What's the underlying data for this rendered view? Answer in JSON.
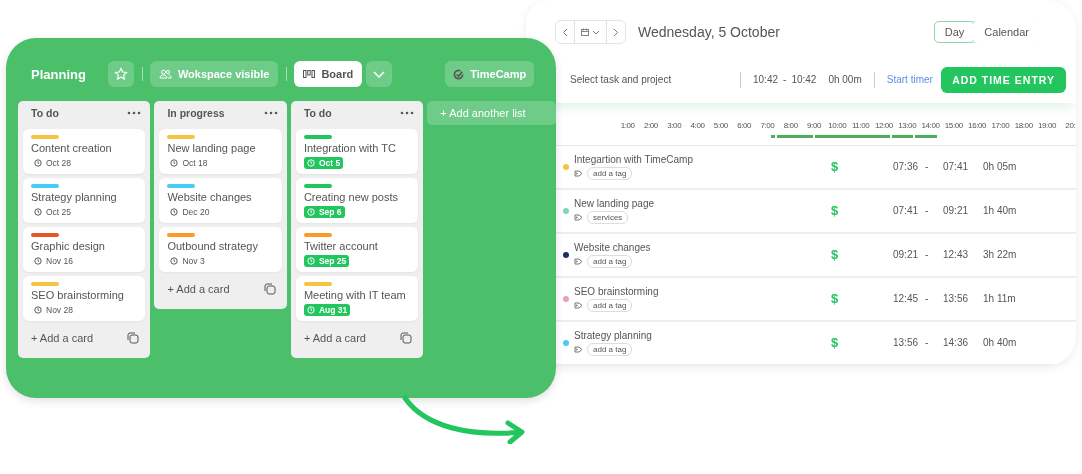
{
  "board": {
    "title": "Planning",
    "visibility": "Wokspace visible",
    "view": "Board",
    "integration": "TimeCamp",
    "lists": [
      {
        "title": "To do",
        "footer": "+ Add a card",
        "cards": [
          {
            "title": "Content creation",
            "color": "#f5c542",
            "date": "Oct 28",
            "highlighted": false
          },
          {
            "title": "Strategy planning",
            "color": "#45cdf5",
            "date": "Oct 25",
            "highlighted": false
          },
          {
            "title": "Graphic design",
            "color": "#e8542a",
            "date": "Nov 16",
            "highlighted": false
          },
          {
            "title": "SEO brainstorming",
            "color": "#f5c542",
            "date": "Nov 28",
            "highlighted": false
          }
        ]
      },
      {
        "title": "In progress",
        "footer": "+ Add a card",
        "cards": [
          {
            "title": "New landing page",
            "color": "#f5c542",
            "date": "Oct 18",
            "highlighted": false
          },
          {
            "title": "Website changes",
            "color": "#45cdf5",
            "date": "Dec 20",
            "highlighted": false
          },
          {
            "title": "Outbound strategy",
            "color": "#fb9a25",
            "date": "Nov 3",
            "highlighted": false
          }
        ]
      },
      {
        "title": "To do",
        "footer": "+ Add a card",
        "cards": [
          {
            "title": "Integration with TC",
            "color": "#22c55e",
            "date": "Oct 5",
            "highlighted": true
          },
          {
            "title": "Creating new posts",
            "color": "#22c55e",
            "date": "Sep 6",
            "highlighted": true
          },
          {
            "title": "Twitter account",
            "color": "#fb9a25",
            "date": "Sep 25",
            "highlighted": true
          },
          {
            "title": "Meeting with IT team",
            "color": "#f5c542",
            "date": "Aug 31",
            "highlighted": true
          }
        ]
      }
    ],
    "add_list": "+ Add another list"
  },
  "timesheet": {
    "date": "Wednesday, 5 October",
    "views": [
      {
        "label": "Day",
        "selected": true
      },
      {
        "label": "Calendar",
        "selected": false
      }
    ],
    "entry": {
      "placeholder": "Select task and project",
      "start": "10:42",
      "separator": "-",
      "end": "10:42",
      "duration": "0h 00m",
      "timer_link": "Start timer",
      "add_button": "ADD TIME ENTRY"
    },
    "hours": [
      "1:00",
      "2:00",
      "3:00",
      "4:00",
      "5:00",
      "6:00",
      "7:00",
      "8:00",
      "9:00",
      "10:00",
      "11:00",
      "12:00",
      "13:00",
      "14:00",
      "15:00",
      "16:00",
      "17:00",
      "18:00",
      "19:00",
      "20:"
    ],
    "entries": [
      {
        "task": "Integartion with TimeCamp",
        "color": "#f5c542",
        "tag": "add a tag",
        "billable": "$",
        "start": "07:36",
        "separator": "-",
        "end": "07:41",
        "duration": "0h 05m"
      },
      {
        "task": "New landing page",
        "color": "#7fd6b8",
        "tag": "services",
        "billable": "$",
        "start": "07:41",
        "separator": "-",
        "end": "09:21",
        "duration": "1h 40m"
      },
      {
        "task": "Website changes",
        "color": "#1b2e6b",
        "tag": "add a tag",
        "billable": "$",
        "start": "09:21",
        "separator": "-",
        "end": "12:43",
        "duration": "3h 22m"
      },
      {
        "task": "SEO brainstorming",
        "color": "#eaa2b8",
        "tag": "add a tag",
        "billable": "$",
        "start": "12:45",
        "separator": "-",
        "end": "13:56",
        "duration": "1h 11m"
      },
      {
        "task": "Strategy planning",
        "color": "#45cdf5",
        "tag": "add a tag",
        "billable": "$",
        "start": "13:56",
        "separator": "-",
        "end": "14:36",
        "duration": "0h 40m"
      }
    ]
  }
}
